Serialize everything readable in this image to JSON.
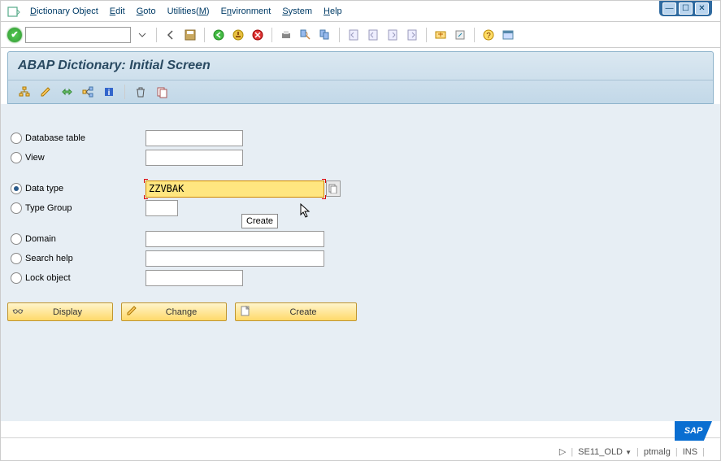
{
  "menu": {
    "items": [
      "Dictionary Object",
      "Edit",
      "Goto",
      "Utilities(M)",
      "Environment",
      "System",
      "Help"
    ]
  },
  "title": "ABAP Dictionary: Initial Screen",
  "radios": {
    "db_table": "Database table",
    "view": "View",
    "data_type": "Data type",
    "type_group": "Type Group",
    "domain": "Domain",
    "search_help": "Search help",
    "lock_object": "Lock object"
  },
  "data_type_value": "ZZVBAK",
  "buttons": {
    "display": "Display",
    "change": "Change",
    "create": "Create"
  },
  "tooltip": "Create",
  "status": {
    "tcode": "SE11_OLD",
    "user": "ptmalg",
    "mode": "INS"
  },
  "logo": "SAP"
}
